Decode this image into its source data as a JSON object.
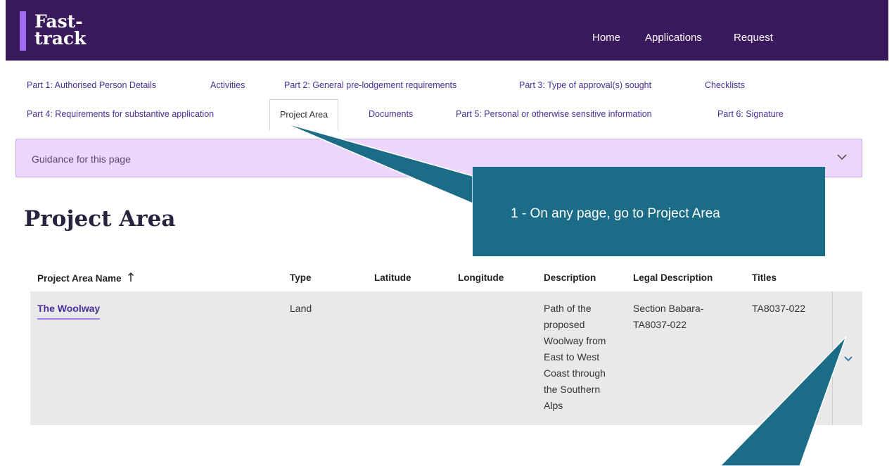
{
  "header": {
    "logo_line1": "Fast-",
    "logo_line2": "track",
    "nav": [
      "Home",
      "Applications",
      "Request"
    ]
  },
  "tabs": {
    "row1": [
      "Part 1: Authorised Person Details",
      "Activities",
      "Part 2: General pre-lodgement requirements",
      "Part 3: Type of approval(s) sought",
      "Checklists"
    ],
    "row2": [
      "Part 4: Requirements for substantive application",
      "Project Area",
      "Documents",
      "Part 5: Personal or otherwise sensitive information",
      "Part 6: Signature"
    ],
    "active": "Project Area"
  },
  "guidance": {
    "label": "Guidance for this page",
    "icon": "chevron-down-icon"
  },
  "page": {
    "title": "Project Area"
  },
  "table": {
    "headers": [
      "Project Area Name",
      "Type",
      "Latitude",
      "Longitude",
      "Description",
      "Legal Description",
      "Titles"
    ],
    "sort_icon": "arrow-up-icon",
    "rows": [
      {
        "name": "The Woolway",
        "type": "Land",
        "latitude": "",
        "longitude": "",
        "description_lines": [
          "Path of the",
          "proposed",
          "Woolway from",
          "East to West",
          "Coast through",
          "the Southern",
          "Alps"
        ],
        "legal_lines": [
          "Section Babara-",
          "TA8037-022"
        ],
        "titles": "TA8037-022"
      }
    ],
    "expand_icon": "chevron-down-icon"
  },
  "callout": {
    "text": "1 - On any page, go to Project Area"
  },
  "colors": {
    "header_bg": "#3a1a5c",
    "logo_accent": "#a06cf2",
    "link": "#4a2f9a",
    "guidance_bg": "#ecd6fb",
    "callout_bg": "#1b6c86",
    "row_bg": "#e9e9e9"
  }
}
